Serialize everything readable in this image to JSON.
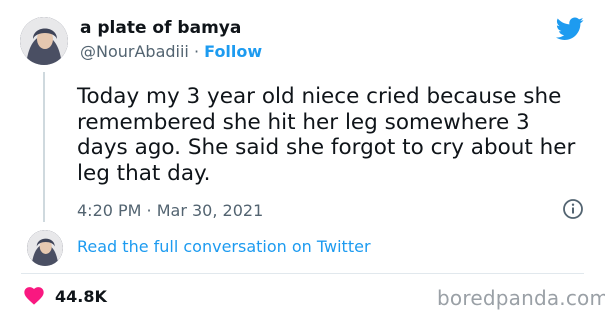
{
  "author": {
    "display_name": "a plate of bamya",
    "handle": "@NourAbadiii",
    "separator": "·",
    "follow_label": "Follow"
  },
  "tweet": {
    "text": "Today my 3 year old niece cried because she remembered she hit her leg somewhere 3 days ago. She said she forgot to cry about her leg that day.",
    "timestamp": "4:20 PM · Mar 30, 2021"
  },
  "thread": {
    "read_more_label": "Read the full conversation on Twitter"
  },
  "engagement": {
    "likes": "44.8K"
  },
  "watermark": "boredpanda.com",
  "icons": {
    "brand": "twitter-bird-icon",
    "like": "heart-icon",
    "info": "info-icon"
  },
  "colors": {
    "accent": "#1d9bf0",
    "like": "#f91880",
    "text": "#0f1419",
    "secondary": "#536471"
  }
}
